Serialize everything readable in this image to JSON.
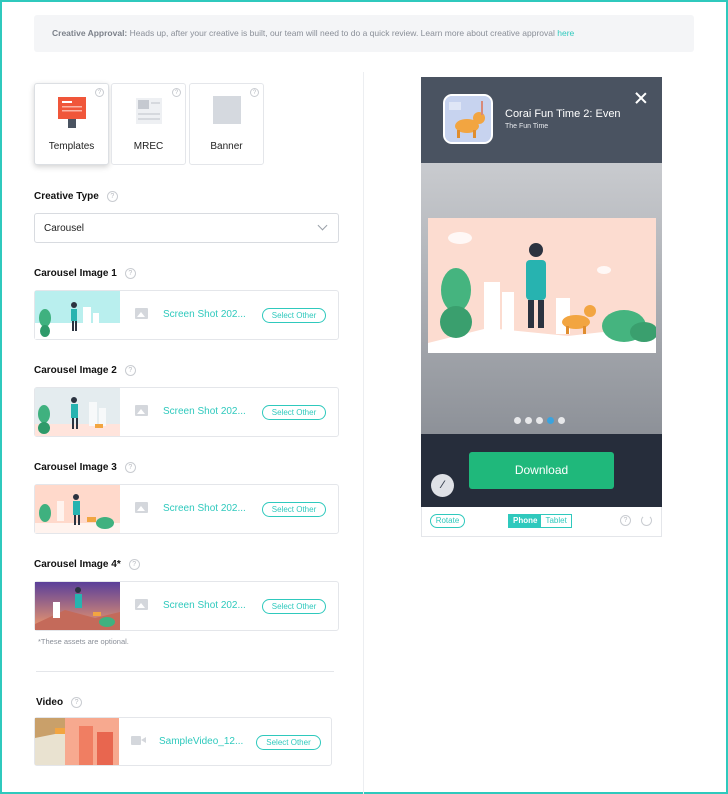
{
  "notice": {
    "title": "Creative Approval:",
    "text": "Heads up, after your creative is built, our team will need to do a quick review. Learn more about creative approval",
    "link": "here"
  },
  "format_tiles": [
    {
      "label": "Templates",
      "active": true
    },
    {
      "label": "MREC",
      "active": false
    },
    {
      "label": "Banner",
      "active": false
    }
  ],
  "creative_type": {
    "label": "Creative Type",
    "value": "Carousel"
  },
  "carousel_images": [
    {
      "label": "Carousel Image 1",
      "filename": "Screen Shot 202...",
      "action": "Select Other"
    },
    {
      "label": "Carousel Image 2",
      "filename": "Screen Shot 202...",
      "action": "Select Other"
    },
    {
      "label": "Carousel Image 3",
      "filename": "Screen Shot 202...",
      "action": "Select Other"
    },
    {
      "label": "Carousel Image 4*",
      "filename": "Screen Shot 202...",
      "action": "Select Other"
    }
  ],
  "optional_note": "*These assets are optional.",
  "video": {
    "label": "Video",
    "filename": "SampleVideo_12...",
    "action": "Select Other"
  },
  "preview": {
    "app_title": "Corai Fun Time 2: Even",
    "app_subtitle": "The Fun Time",
    "download_label": "Download",
    "active_dot": 4,
    "dot_count": 5,
    "rotate_label": "Rotate",
    "device_phone": "Phone",
    "device_tablet": "Tablet",
    "active_device": "Phone"
  },
  "colors": {
    "accent": "#2fc9bd",
    "download": "#1fb87b",
    "active_dot": "#3ba3de"
  }
}
